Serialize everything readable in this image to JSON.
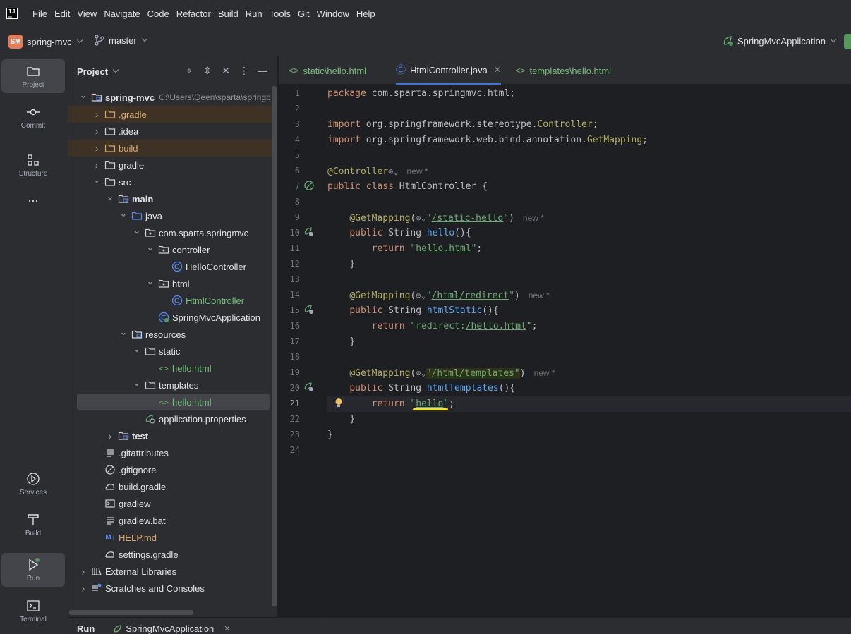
{
  "menu": [
    "File",
    "Edit",
    "View",
    "Navigate",
    "Code",
    "Refactor",
    "Build",
    "Run",
    "Tools",
    "Git",
    "Window",
    "Help"
  ],
  "toolbar": {
    "project_badge": "SM",
    "project_name": "spring-mvc",
    "branch": "master",
    "run_config": "SpringMvcApplication"
  },
  "left_strip": {
    "project": "Project",
    "commit": "Commit",
    "structure": "Structure",
    "more": "...",
    "services": "Services",
    "build": "Build",
    "run": "Run",
    "terminal": "Terminal"
  },
  "project_panel": {
    "title": "Project",
    "root_name": "spring-mvc",
    "root_path": "C:\\Users\\Qeen\\sparta\\springp",
    "items": [
      {
        "label": "spring-mvc"
      },
      {
        "label": ".gradle"
      },
      {
        "label": ".idea"
      },
      {
        "label": "build"
      },
      {
        "label": "gradle"
      },
      {
        "label": "src"
      },
      {
        "label": "main"
      },
      {
        "label": "java"
      },
      {
        "label": "com.sparta.springmvc"
      },
      {
        "label": "controller"
      },
      {
        "label": "HelloController"
      },
      {
        "label": "html"
      },
      {
        "label": "HtmlController"
      },
      {
        "label": "SpringMvcApplication"
      },
      {
        "label": "resources"
      },
      {
        "label": "static"
      },
      {
        "label": "hello.html"
      },
      {
        "label": "templates"
      },
      {
        "label": "hello.html"
      },
      {
        "label": "application.properties"
      },
      {
        "label": "test"
      },
      {
        "label": ".gitattributes"
      },
      {
        "label": ".gitignore"
      },
      {
        "label": "build.gradle"
      },
      {
        "label": "gradlew"
      },
      {
        "label": "gradlew.bat"
      },
      {
        "label": "HELP.md"
      },
      {
        "label": "settings.gradle"
      },
      {
        "label": "External Libraries"
      },
      {
        "label": "Scratches and Consoles"
      }
    ]
  },
  "tabs": [
    {
      "label": "static\\hello.html"
    },
    {
      "label": "HtmlController.java"
    },
    {
      "label": "templates\\hello.html"
    }
  ],
  "editor": {
    "line_numbers": [
      "1",
      "2",
      "3",
      "4",
      "5",
      "6",
      "7",
      "8",
      "9",
      "10",
      "11",
      "12",
      "13",
      "14",
      "15",
      "16",
      "17",
      "18",
      "19",
      "20",
      "21",
      "22",
      "23",
      "24"
    ],
    "code": {
      "l1a": "package",
      "l1b": " com.sparta.springmvc.html;",
      "l3a": "import",
      "l3b": " org.springframework.stereotype.",
      "l3c": "Controller",
      "l3d": ";",
      "l4a": "import",
      "l4b": " org.springframework.web.bind.annotation.",
      "l4c": "GetMapping",
      "l4d": ";",
      "l6a": "@Controller",
      "hint_new": "new *",
      "l7a": "public class",
      "l7b": " HtmlController {",
      "l9a": "@GetMapping",
      "l9b": "/static-hello",
      "l10a": "public",
      "l10b": " String ",
      "l10c": "hello",
      "l10d": "(){",
      "l11a": "return",
      "l11b": "hello.html",
      "brace": "}",
      "l14b": "/html/redirect",
      "l15c": "htmlStatic",
      "l16b": "redirect:/hello.html",
      "l16b1": "redirect:",
      "l16b2": "/hello.html",
      "l19b": "/html/templates",
      "l20c": "htmlTemplates",
      "l21b": "hello"
    }
  },
  "bottom": {
    "run": "Run",
    "app": "SpringMvcApplication"
  },
  "colors": {
    "accent": "#3574f0",
    "keyword": "#cf8e6d",
    "string": "#6aab73",
    "annotation": "#b3ae60",
    "function": "#56a8f5",
    "highlight_marker": "#f4e80a"
  }
}
